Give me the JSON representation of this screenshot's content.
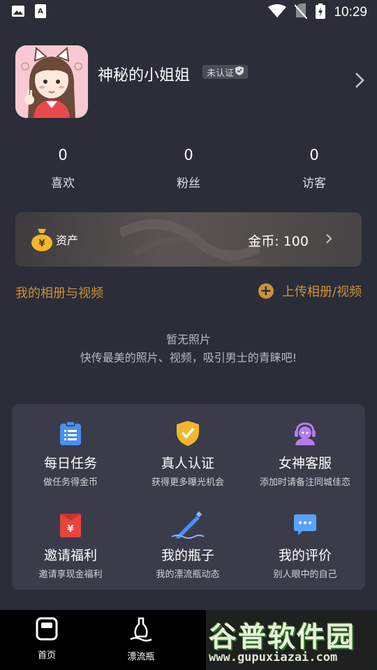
{
  "status_bar": {
    "time": "10:29"
  },
  "profile": {
    "nickname": "神秘的小姐姐",
    "verify_badge": "未认证"
  },
  "stats": [
    {
      "value": "0",
      "label": "喜欢"
    },
    {
      "value": "0",
      "label": "粉丝"
    },
    {
      "value": "0",
      "label": "访客"
    }
  ],
  "assets": {
    "label": "资产",
    "coins": "金币: 100"
  },
  "album": {
    "title": "我的相册与视频",
    "upload_label": "上传相册/视频",
    "empty_title": "暂无照片",
    "empty_desc": "快传最美的照片、视频，吸引男士的青睐吧!"
  },
  "features": [
    {
      "title": "每日任务",
      "sub": "做任务得金币",
      "icon": "task-list-icon",
      "color": "#4b8ef1"
    },
    {
      "title": "真人认证",
      "sub": "获得更多曝光机会",
      "icon": "shield-check-icon",
      "color": "#f1b72c"
    },
    {
      "title": "女神客服",
      "sub": "添加时请备注同城佳恋",
      "icon": "headset-icon",
      "color": "#b57cf0"
    },
    {
      "title": "邀请福利",
      "sub": "邀请享现金福利",
      "icon": "red-envelope-icon",
      "color": "#e8443d"
    },
    {
      "title": "我的瓶子",
      "sub": "我的漂流瓶动态",
      "icon": "bottle-icon",
      "color": "#4b8ef1"
    },
    {
      "title": "我的评价",
      "sub": "别人眼中的自己",
      "icon": "comment-icon",
      "color": "#5aa2f5"
    }
  ],
  "bottom_nav": [
    {
      "label": "首页",
      "icon": "home-icon"
    },
    {
      "label": "漂流瓶",
      "icon": "bottle-nav-icon"
    }
  ],
  "watermark": {
    "text": "谷普软件园",
    "url": "www.gupuxiazai.com"
  }
}
